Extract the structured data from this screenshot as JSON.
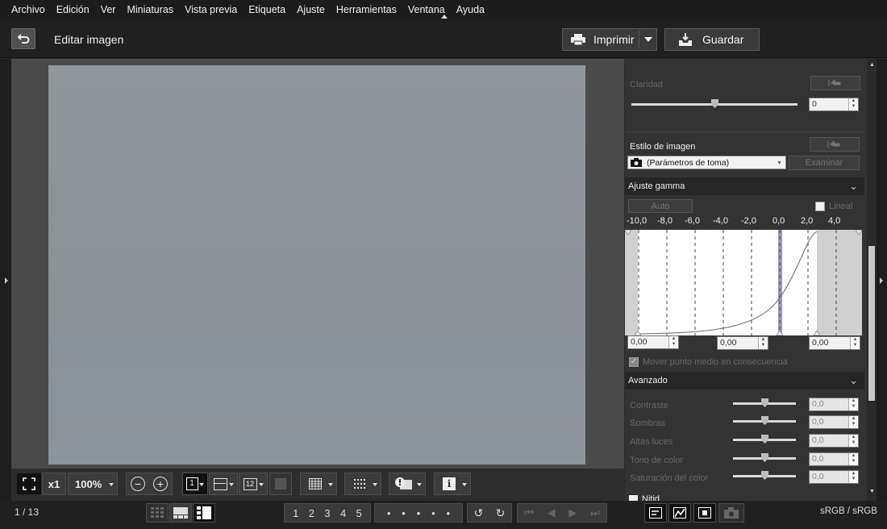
{
  "menu": [
    "Archivo",
    "Edición",
    "Ver",
    "Miniaturas",
    "Vista previa",
    "Etiqueta",
    "Ajuste",
    "Herramientas",
    "Ventana",
    "Ayuda"
  ],
  "header": {
    "title": "Editar imagen",
    "print_label": "Imprimir",
    "save_label": "Guardar"
  },
  "view_toolbar": {
    "zoom_multiplier": "x1",
    "zoom_level": "100%"
  },
  "panel": {
    "clarity": {
      "label": "Claridad",
      "value": "0"
    },
    "picture_style": {
      "label": "Estilo de imagen",
      "value": "(Parámetros de toma)",
      "browse_label": "Examinar"
    },
    "gamma": {
      "title": "Ajuste gamma",
      "auto_label": "Auto",
      "linear_label": "Lineal",
      "scale": [
        "-10,0",
        "-8,0",
        "-6,0",
        "-4,0",
        "-2,0",
        "0,0",
        "2,0",
        "4,0"
      ],
      "spin_left": "0,00",
      "spin_mid": "0,00",
      "spin_right": "0,00",
      "checkbox_label": "Mover punto medio en consecuencia"
    },
    "advanced": {
      "title": "Avanzado",
      "rows": [
        {
          "label": "Contraste",
          "value": "0,0"
        },
        {
          "label": "Sombras",
          "value": "0,0"
        },
        {
          "label": "Altas luces",
          "value": "0,0"
        },
        {
          "label": "Tono de color",
          "value": "0,0"
        },
        {
          "label": "Saturación del color",
          "value": "0,0"
        }
      ],
      "next_label": "Nitid"
    }
  },
  "status": {
    "page": "1 / 13",
    "color_space": "sRGB / sRGB",
    "ratings": [
      "1",
      "2",
      "3",
      "4",
      "5"
    ]
  }
}
